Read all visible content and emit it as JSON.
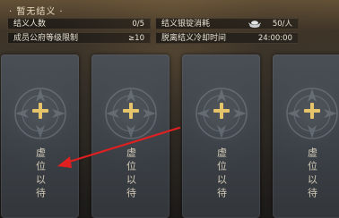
{
  "header": {
    "title": "· 暂无结义 ·"
  },
  "stats": {
    "member_count_label": "结义人数",
    "member_count_value": "0/5",
    "rank_limit_label": "成员公府等级限制",
    "rank_limit_value": "≥10",
    "silver_cost_label": "结义银锭消耗",
    "silver_cost_value": "50/人",
    "cooldown_label": "脱离结义冷却时间",
    "cooldown_value": "24:00:00"
  },
  "slots": [
    {
      "status": "虚位以待"
    },
    {
      "status": "虚位以待"
    },
    {
      "status": "虚位以待"
    },
    {
      "status": "虚位以待"
    }
  ],
  "icons": {
    "plus": "plus-icon",
    "silver": "silver-ingot-icon",
    "emblem": "emblem-icon"
  },
  "colors": {
    "plus": "#e6c46a",
    "arrow": "#e02020"
  }
}
